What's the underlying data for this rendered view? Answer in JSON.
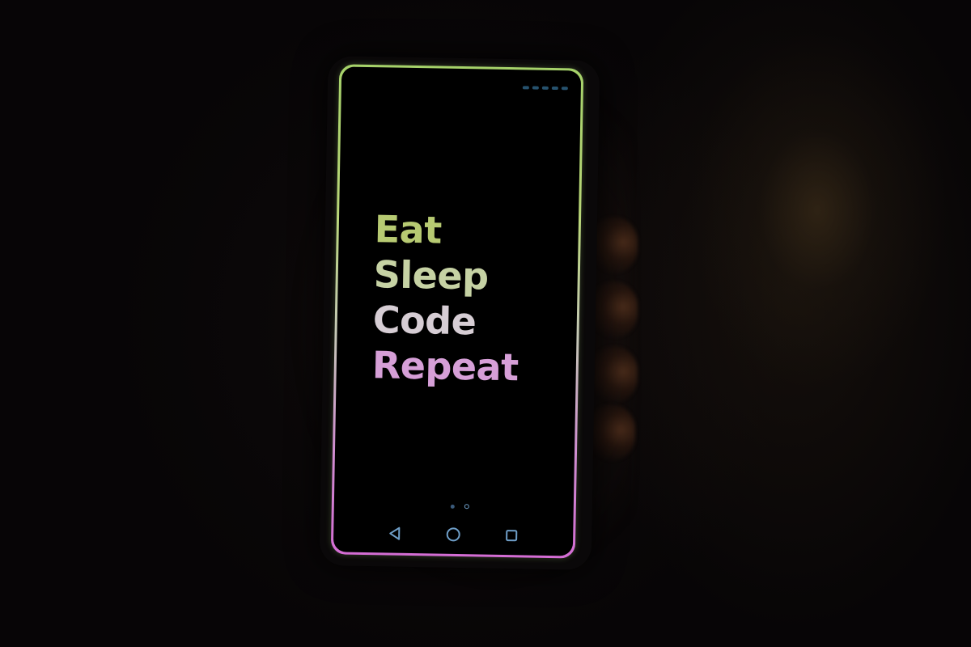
{
  "photo": {
    "scene": "dark-room-hand-holding-phone"
  },
  "phone": {
    "message_lines": [
      "Eat",
      "Sleep",
      "Code",
      "Repeat"
    ],
    "colors": {
      "border_top": "#a6d26a",
      "border_bottom": "#d46dd4",
      "text_line_1": "#b7ca72",
      "text_line_2": "#c6d2a4",
      "text_line_3": "#d6cdd4",
      "text_line_4": "#d69fd7",
      "nav_icons": "#6f9fc9"
    },
    "page_indicator": {
      "pages": 2,
      "current": 2
    },
    "nav_icons": [
      "back-icon",
      "home-icon",
      "recents-icon"
    ]
  }
}
